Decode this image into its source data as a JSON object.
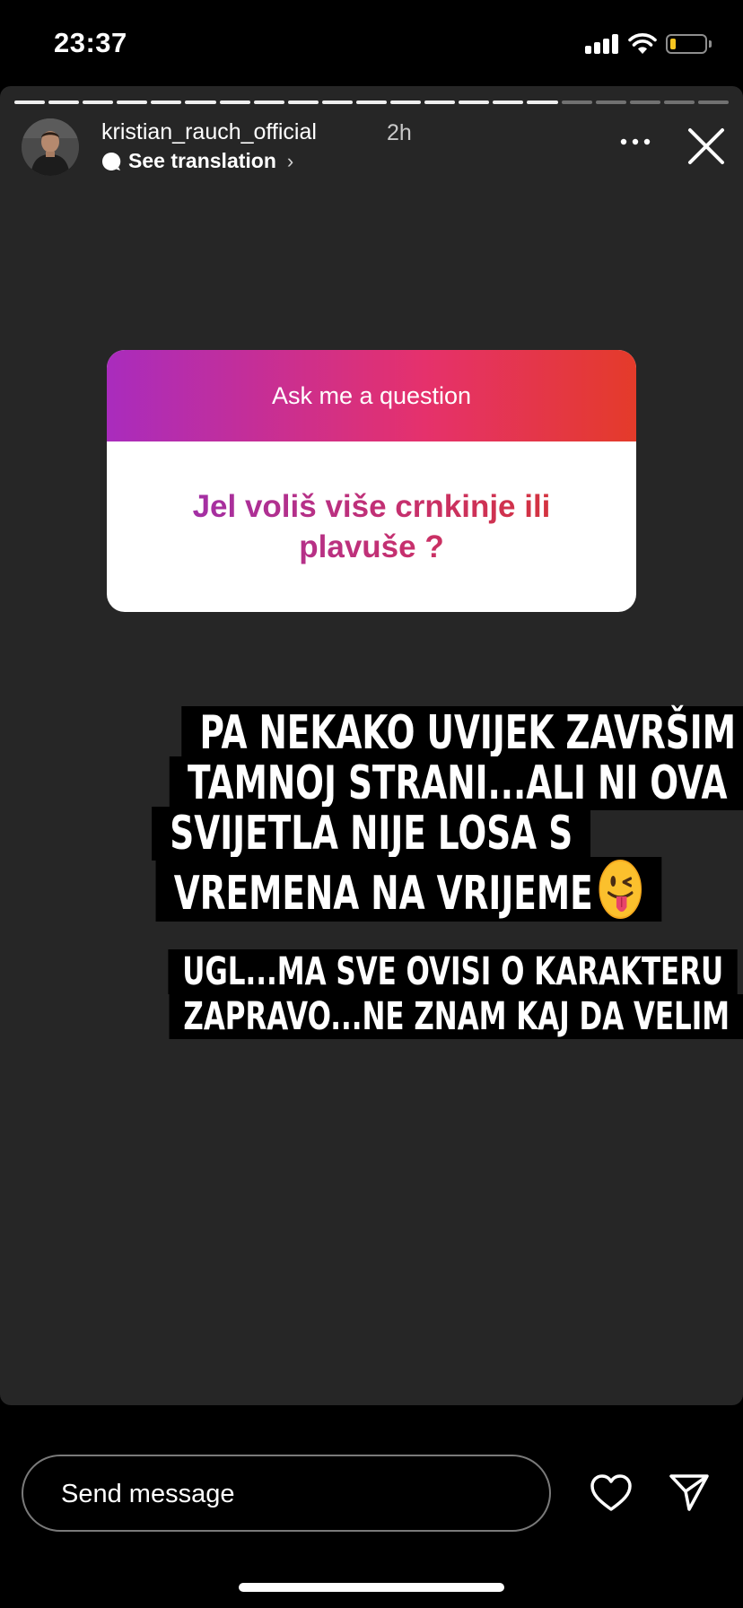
{
  "status_bar": {
    "time": "23:37"
  },
  "story": {
    "progress": {
      "total_segments": 21,
      "completed_segments": 16
    },
    "header": {
      "username": "kristian_rauch_official",
      "time_ago": "2h",
      "translation_label": "See translation"
    },
    "question_sticker": {
      "title": "Ask me a question",
      "question": "Jel voliš više crnkinje ili plavuše ?"
    },
    "caption_1": {
      "lines": [
        "PA NEKAKO UVIJEK ZAVRŠIM NA",
        "TAMNOJ STRANI...ALI NI OVA",
        "SVIJETLA NIJE LOSA S",
        "VREMENA NA VRIJEME"
      ],
      "emoji": "winking-face-with-tongue"
    },
    "caption_2": {
      "lines": [
        "UGL...MA SVE OVISI O KARAKTERU",
        "ZAPRAVO...NE ZNAM KAJ DA VELIM"
      ]
    }
  },
  "bottom_bar": {
    "message_placeholder": "Send message"
  },
  "colors": {
    "story_background": "#262626",
    "sticker_gradient_start": "#a92cbd",
    "sticker_gradient_end": "#e43b2a",
    "battery_level": "#f7c520"
  }
}
